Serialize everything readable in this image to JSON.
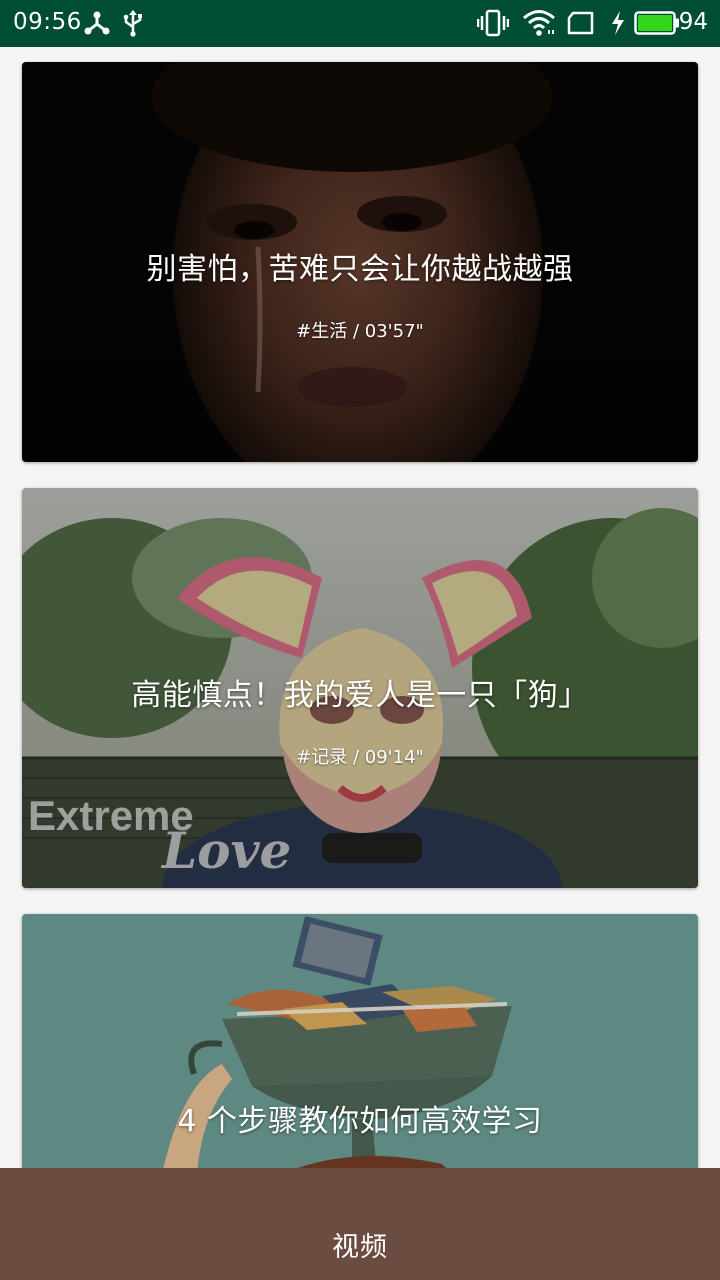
{
  "status_bar": {
    "time": "09:56",
    "battery_level": "94",
    "left_icons": [
      "network-share-icon",
      "usb-icon"
    ],
    "right_icons": [
      "vibrate-icon",
      "wifi-icon",
      "sim-icon",
      "charging-icon",
      "battery-icon"
    ]
  },
  "feed": {
    "cards": [
      {
        "title": "别害怕，苦难只会让你越战越强",
        "meta": "#生活 / 03'57\""
      },
      {
        "title": "高能慎点！我的爱人是一只「狗」",
        "meta": "#记录 / 09'14\"",
        "watermark_text": "Extreme Love"
      },
      {
        "title": "4 个步骤教你如何高效学习"
      }
    ]
  },
  "bottom_bar": {
    "label": "视频"
  },
  "colors": {
    "status_bar": "#004d35",
    "bottom_bar": "#6b4c40",
    "battery_fill": "#33d61c"
  }
}
